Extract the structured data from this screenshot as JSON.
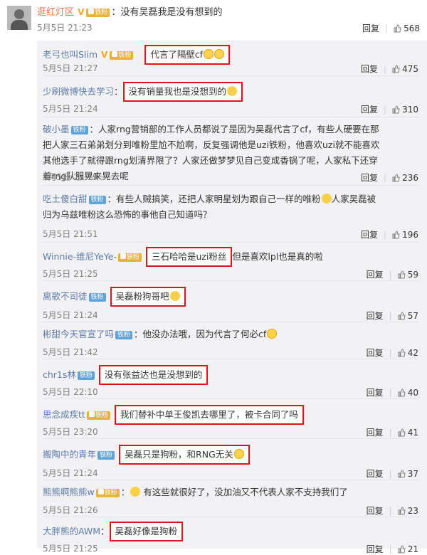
{
  "top_comment": {
    "user": "逛红灯区",
    "separator": "：",
    "text": "没有吴磊我是没有想到的",
    "date": "5月5日 21:23",
    "reply_label": "回复",
    "likes": "568"
  },
  "replies": [
    {
      "user": "老弓也叫Slim",
      "vip": "V",
      "badge": "铁粉",
      "text": "代言了隔壁cf",
      "emoji": "face",
      "date": "5月5日 21:27",
      "reply_label": "回复",
      "likes": "475"
    },
    {
      "user": "少刷微博快去学习",
      "badge": "",
      "text": "没有销量我也是没想到的",
      "emoji": "cry",
      "date": "5月5日 21:24",
      "reply_label": "回复",
      "likes": "310"
    },
    {
      "user": "破小墨",
      "badge": "铁粉",
      "text": "人家rng营销部的工作人员都说了是因为吴磊代言了cf，有些人硬要在那把人家三石弟弟划分到唯粉里尬不尬啊，反复强调他是uzi铁粉，他喜欢uzi就不能喜欢其他选手了就得跟rng划清界限了？人家还做梦梦见自己变成香锅了呢，人家私下还穿着rng队服晃来晃去呢",
      "date": "5月5日 23:19",
      "reply_label": "回复",
      "likes": "236"
    },
    {
      "user": "吃土傻白甜",
      "badge": "铁粉",
      "text": "有些人贼搞笑，还把人家明星划为跟自己一样的唯粉",
      "text2": "人家吴磊被归为乌兹唯粉这么恐怖的事他自己知道吗？",
      "date": "5月5日 21:51",
      "reply_label": "回复",
      "likes": "196"
    },
    {
      "user": "Winnie-维尼YeYe-",
      "vip_icon": true,
      "badge": "铁粉",
      "text": "三石哈哈是uzi粉丝",
      "text2": "但是喜欢lpl也是真的啦",
      "date": "5月5日 21:25",
      "reply_label": "回复",
      "likes": "59"
    },
    {
      "user": "离歌不司徒",
      "badge": "铁粉",
      "text": "吴磊粉狗哥吧",
      "emoji": "cry",
      "date": "5月5日 21:24",
      "reply_label": "回复",
      "likes": "57"
    },
    {
      "user": "彬甜今天官宣了吗",
      "badge": "铁粉",
      "text": "他没办法哦，因为代言了何必cf",
      "emoji": "face",
      "date": "5月5日 21:42",
      "reply_label": "回复",
      "likes": "42"
    },
    {
      "user": "chr1s林",
      "badge": "铁粉",
      "text": "没有张益达也是没想到的",
      "date": "5月5日 22:10",
      "reply_label": "回复",
      "likes": "40"
    },
    {
      "user": "思念成疾tt",
      "vip_icon": true,
      "badge": "铁粉",
      "text": "我们替补中单王俊凯去哪里了，被卡合同了吗",
      "date": "5月5日 23:20",
      "reply_label": "回复",
      "likes": "41"
    },
    {
      "user": "搬陶中的青年",
      "badge": "铁粉",
      "text": "吴磊只是狗粉，和RNG无关",
      "emoji": "face",
      "date": "5月5日 21:24",
      "reply_label": "回复",
      "likes": "37"
    },
    {
      "user": "熊熊啊熊熊w",
      "vip_icon": true,
      "badge": "铁粉",
      "text": "有这些就很好了，没加油又不代表人家不支持我们了",
      "date": "5月5日 21:26",
      "reply_label": "回复",
      "likes": "23"
    },
    {
      "user": "大胖熊的AWM",
      "text": "吴磊好像是狗粉",
      "date": "5月5日 21:25",
      "reply_label": "回复",
      "likes": "21"
    }
  ]
}
